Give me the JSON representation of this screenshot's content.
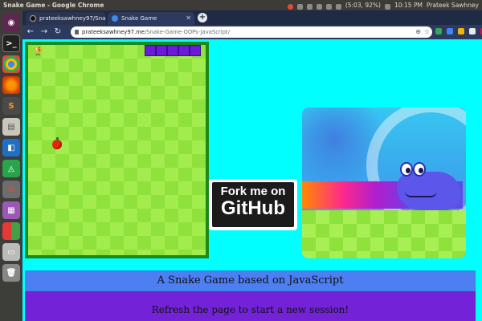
{
  "os_bar": {
    "title": "Snake Game - Google Chrome",
    "battery": "(5:03, 92%)",
    "time": "10:15 PM",
    "user": "Prateek Sawhney"
  },
  "tabs": [
    {
      "label": "prateeksawhney97/Snak",
      "active": false
    },
    {
      "label": "Snake Game",
      "active": true
    }
  ],
  "url": {
    "host": "prateeksawhney97.me",
    "path": "/Snake-Game-OOPs-JavaScript/"
  },
  "game": {
    "score": "5"
  },
  "github": {
    "line1": "Fork me on",
    "line2": "GitHub"
  },
  "footer": {
    "heading": "A Snake Game based on JavaScript",
    "hint": "Refresh the page to start a new session!"
  },
  "colors": {
    "page_bg": "#00ffff",
    "board_border": "#1b8a1b",
    "snake": "#6a1bd6",
    "band_blue": "#4d7ef2",
    "band_purple": "#7322d8"
  }
}
